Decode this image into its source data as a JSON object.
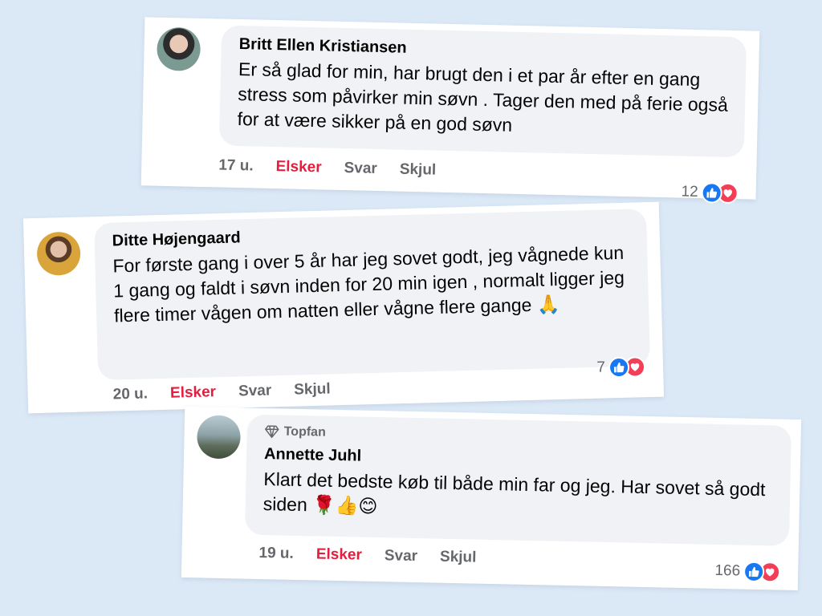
{
  "comments": [
    {
      "name": "Britt Ellen Kristiansen",
      "text": "Er så glad for min, har brugt den i et par år efter en gang stress som påvirker min søvn . Tager den med på ferie også for at være sikker på en god søvn",
      "time": "17 u.",
      "love_label": "Elsker",
      "reply_label": "Svar",
      "hide_label": "Skjul",
      "reaction_count": "12"
    },
    {
      "name": "Ditte Højengaard",
      "text": "For første gang i over 5 år har jeg sovet godt, jeg vågnede kun 1 gang og faldt i søvn inden for 20 min igen , normalt ligger jeg flere timer vågen om natten eller vågne flere gange 🙏",
      "time": "20 u.",
      "love_label": "Elsker",
      "reply_label": "Svar",
      "hide_label": "Skjul",
      "reaction_count": "7"
    },
    {
      "badge": "Topfan",
      "name": "Annette Juhl",
      "text": "Klart det bedste køb til både min far og jeg. Har sovet så godt siden 🌹👍😊",
      "time": "19 u.",
      "love_label": "Elsker",
      "reply_label": "Svar",
      "hide_label": "Skjul",
      "reaction_count": "166"
    }
  ],
  "colors": {
    "background": "#dbe9f7",
    "bubble": "#f0f2f5",
    "love_red": "#e41e3f",
    "like_blue": "#1877f2",
    "heart_red": "#f33e58",
    "meta_gray": "#65676b"
  },
  "icons": [
    "avatar",
    "diamond-icon",
    "like-icon",
    "heart-icon"
  ]
}
